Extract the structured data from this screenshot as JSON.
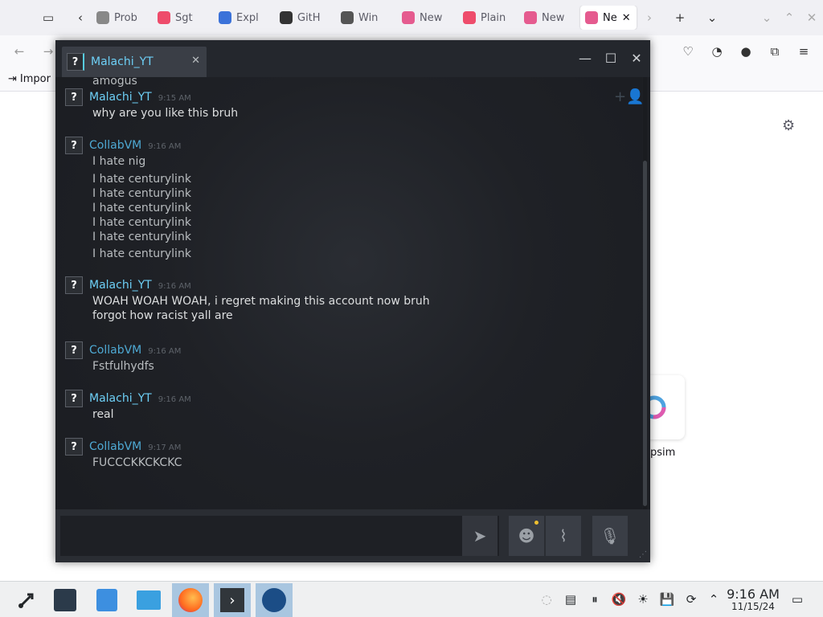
{
  "browser": {
    "tabs": [
      {
        "label": "Prob",
        "color": "#888888"
      },
      {
        "label": "Sgt",
        "color": "#ee4c6b"
      },
      {
        "label": "Expl",
        "color": "#3b72d9"
      },
      {
        "label": "GitH",
        "color": "#333333"
      },
      {
        "label": "Win",
        "color": "#555555"
      },
      {
        "label": "New",
        "color": "#e55b8f"
      },
      {
        "label": "Plain",
        "color": "#ee4c6b"
      },
      {
        "label": "New",
        "color": "#e55b8f"
      },
      {
        "label": "Ne",
        "color": "#e55b8f"
      }
    ],
    "bookmark_label": "Impor"
  },
  "chat": {
    "tab_name": "Malachi_YT",
    "partial_top_line": "amogus",
    "groups": [
      {
        "author": "Malachi_YT",
        "kind": "user",
        "time": "9:15 AM",
        "lines": [
          "why are you like this bruh"
        ]
      },
      {
        "author": "CollabVM",
        "kind": "bot",
        "time": "9:16 AM",
        "lines": [
          "I hate nig",
          "I hate centurylink",
          "I hate centurylink",
          "I hate centurylink",
          "I hate centurylink",
          "I hate centurylink",
          "I hate centurylink"
        ]
      },
      {
        "author": "Malachi_YT",
        "kind": "user",
        "time": "9:16 AM",
        "lines": [
          "WOAH WOAH WOAH, i regret making this account now bruh",
          "forgot how racist yall are"
        ]
      },
      {
        "author": "CollabVM",
        "kind": "bot",
        "time": "9:16 AM",
        "lines": [
          "Fstfulhydfs"
        ]
      },
      {
        "author": "Malachi_YT",
        "kind": "user",
        "time": "9:16 AM",
        "lines": [
          "real"
        ]
      },
      {
        "author": "CollabVM",
        "kind": "bot",
        "time": "9:17 AM",
        "lines": [
          "FUCCCKKCKCKC"
        ]
      }
    ],
    "input_value": ""
  },
  "page": {
    "tile_label": "psim"
  },
  "taskbar": {
    "time": "9:16 AM",
    "date": "11/15/24"
  }
}
